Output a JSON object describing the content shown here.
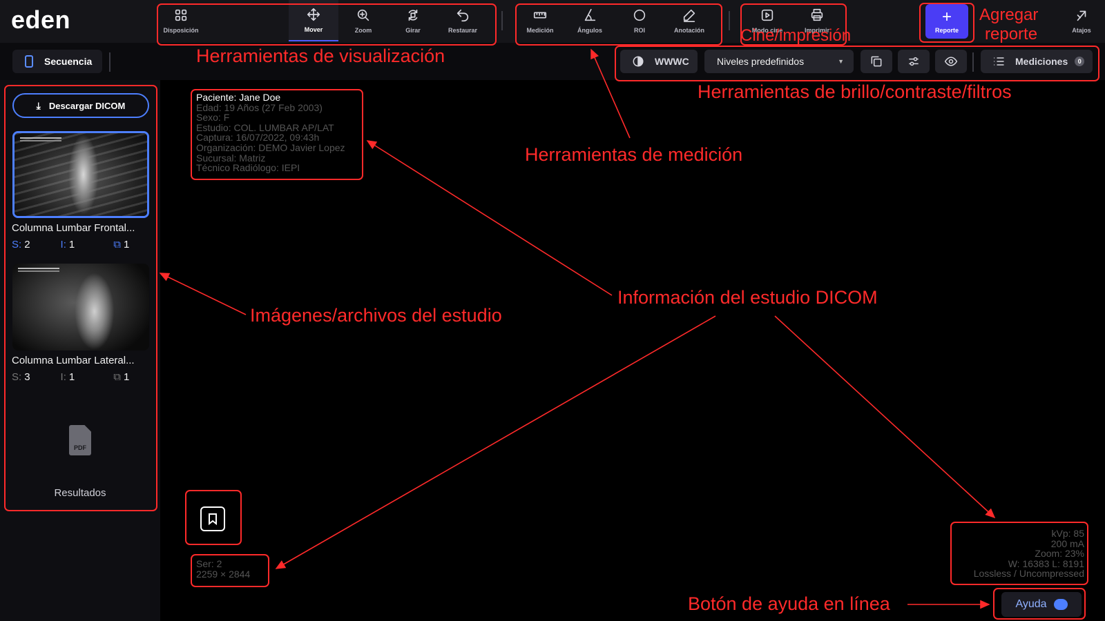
{
  "app": {
    "logo": "eden"
  },
  "toolbar": {
    "view_tools": [
      {
        "label": "Disposición",
        "icon": "grid-icon"
      },
      {
        "label": "Mover",
        "icon": "move-icon",
        "active": true
      },
      {
        "label": "Zoom",
        "icon": "zoom-icon"
      },
      {
        "label": "Girar",
        "icon": "rotate-icon"
      },
      {
        "label": "Restaurar",
        "icon": "undo-icon"
      }
    ],
    "measure_tools": [
      {
        "label": "Medición",
        "icon": "ruler-icon"
      },
      {
        "label": "Ángulos",
        "icon": "angle-icon"
      },
      {
        "label": "ROI",
        "icon": "circle-icon"
      },
      {
        "label": "Anotación",
        "icon": "pencil-icon"
      }
    ],
    "cine_tools": [
      {
        "label": "Modo cine",
        "icon": "play-icon"
      },
      {
        "label": "Imprimir",
        "icon": "printer-icon"
      }
    ],
    "report_label": "Reporte",
    "shortcuts_label": "Atajos"
  },
  "secondary_bar": {
    "sequence_label": "Secuencia",
    "wwwc_label": "WWWC",
    "presets_label": "Niveles predefinidos",
    "measurements_label": "Mediciones",
    "measurements_count": "0"
  },
  "left_panel": {
    "download_label": "Descargar DICOM",
    "studies": [
      {
        "title": "Columna Lumbar Frontal...",
        "s": "2",
        "i": "1",
        "c": "1",
        "selected": true
      },
      {
        "title": "Columna Lumbar Lateral...",
        "s": "3",
        "i": "1",
        "c": "1",
        "selected": false
      }
    ],
    "keys": {
      "s": "S:",
      "i": "I:"
    },
    "pdf_label": "PDF",
    "results_label": "Resultados"
  },
  "viewer": {
    "patient_info": [
      "Paciente: Jane Doe",
      "Edad: 19 Años (27 Feb 2003)",
      "Sexo: F",
      "Estudio: COL. LUMBAR AP/LAT",
      "Captura: 16/07/2022, 09:43h",
      "Organización: DEMO Javier Lopez",
      "Sucursal: Matriz",
      "Técnico Radiólogo: IEPI"
    ],
    "series_info": [
      "Ser: 2",
      "2259 × 2844"
    ],
    "tech_info": [
      "kVp: 85",
      "200 mA",
      "Zoom: 23%",
      "W: 16383 L: 8191",
      "Lossless / Uncompressed"
    ],
    "help_label": "Ayuda"
  },
  "annotations": {
    "view_tools": "Herramientas de visualización",
    "measure_tools": "Herramientas de medición",
    "cine_print": "Cine/impresión",
    "add_report_1": "Agregar",
    "add_report_2": "reporte",
    "brightness_tools": "Herramientas de brillo/contraste/filtros",
    "study_images": "Imágenes/archivos del estudio",
    "dicom_info": "Información del estudio DICOM",
    "help_button": "Botón de ayuda en línea"
  },
  "colors": {
    "accent": "#4a3df5",
    "annotation": "#ff2a2a",
    "link_blue": "#4d7fff"
  }
}
